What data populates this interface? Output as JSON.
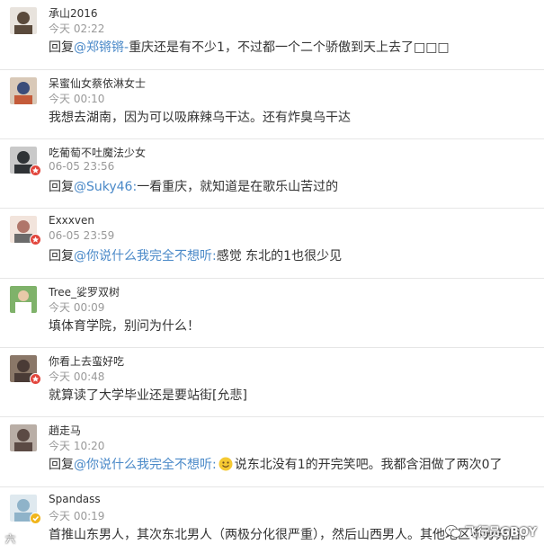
{
  "comments": [
    {
      "user": "承山2016",
      "time": "今天 02:22",
      "badge": "",
      "prefix": "回复",
      "mention": "@郑锵锵-",
      "text": "重庆还是有不少1，不过都一个二个骄傲到天上去了□□□",
      "avatar_color": "#5a4a3c"
    },
    {
      "user": "呆蜜仙女蔡依淋女士",
      "time": "今天 00:10",
      "badge": "",
      "prefix": "",
      "mention": "",
      "text": "我想去湖南，因为可以吸麻辣乌干达。还有炸臭乌干达",
      "avatar_color": "#3b4d7a"
    },
    {
      "user": "吃葡萄不吐魔法少女",
      "time": "06-05 23:56",
      "badge": "red",
      "prefix": "回复",
      "mention": "@Suky46:",
      "text": "一看重庆，就知道是在歌乐山苦过的",
      "avatar_color": "#2f3336"
    },
    {
      "user": "Exxxven",
      "time": "06-05 23:59",
      "badge": "red",
      "prefix": "回复",
      "mention": "@你说什么我完全不想听:",
      "text": "感觉 东北的1也很少见",
      "avatar_color": "#b0766a"
    },
    {
      "user": "Tree_娑罗双树",
      "time": "今天 00:09",
      "badge": "",
      "prefix": "",
      "mention": "",
      "text": "填体育学院，别问为什么！",
      "avatar_color": "#3a7a35"
    },
    {
      "user": "你看上去蛮好吃",
      "time": "今天 00:48",
      "badge": "red",
      "prefix": "",
      "mention": "",
      "text": "就算读了大学毕业还是要站街[允悲]",
      "avatar_color": "#4a3b36"
    },
    {
      "user": "趙走马",
      "time": "今天 10:20",
      "badge": "",
      "prefix": "回复",
      "mention": "@你说什么我完全不想听:",
      "text_before_emoji": "",
      "emoji": "smile-emoji",
      "text": "说东北没有1的开完笑吧。我都含泪做了两次0了",
      "avatar_color": "#5b4a44"
    },
    {
      "user": "Spandass",
      "time": "今天 00:19",
      "badge": "gold",
      "prefix": "",
      "mention": "",
      "text": "首推山东男人，其次东北男人（两极分化很严重），然后山西男人。其他地区不分先后。",
      "avatar_color": "#8fb3c9"
    }
  ],
  "watermark": {
    "text": "飞行员GBOY",
    "left_text": "六"
  }
}
